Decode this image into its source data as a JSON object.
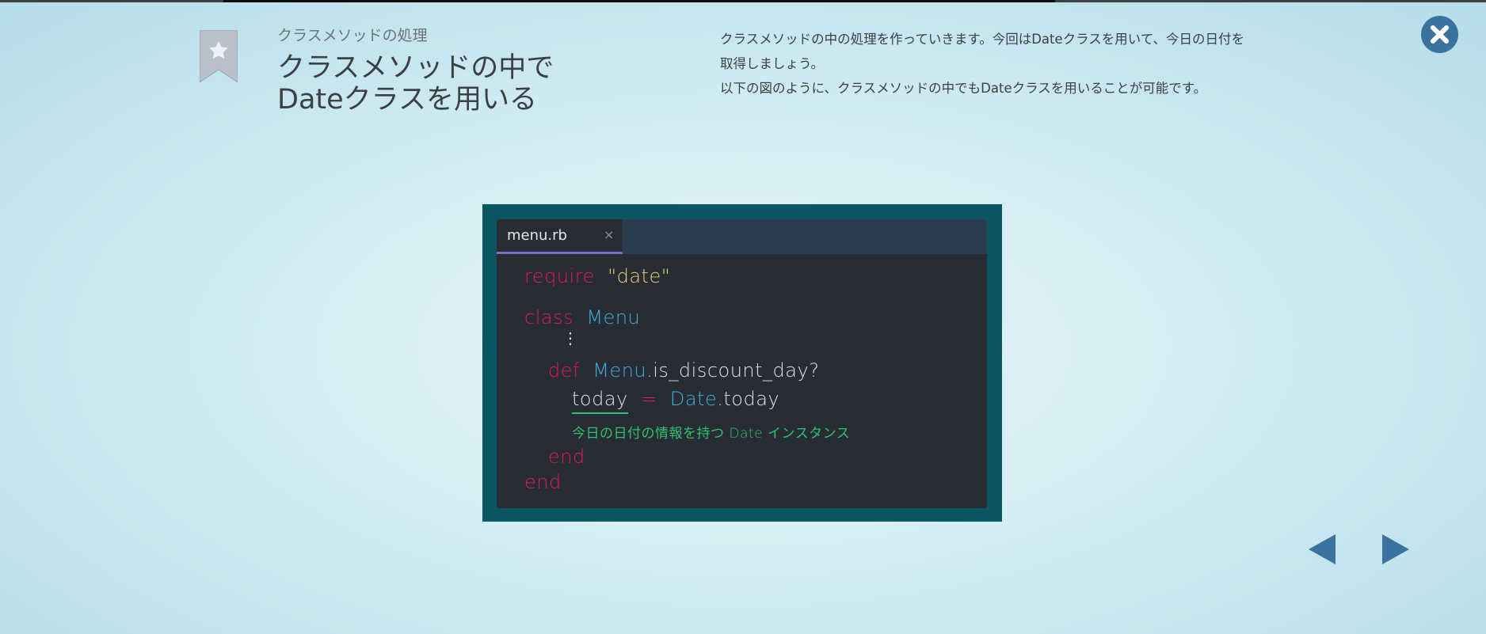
{
  "header": {
    "subtitle": "クラスメソッドの処理",
    "title_line1": "クラスメソッドの中で",
    "title_line2": "Dateクラスを用いる",
    "description": [
      "クラスメソッドの中の処理を作っていきます。今回はDateクラスを用いて、今日の日付を",
      "取得しましょう。",
      "以下の図のように、クラスメソッドの中でもDateクラスを用いることが可能です。"
    ]
  },
  "icons": {
    "bookmark": "bookmark-star-icon",
    "close": "close-icon",
    "prev": "triangle-left-icon",
    "next": "triangle-right-icon"
  },
  "editor": {
    "tab_name": "menu.rb",
    "tab_close": "×",
    "code": {
      "require_kw": "require",
      "require_str": "\"date\"",
      "class_kw": "class",
      "class_name": "Menu",
      "ellipsis": "⋮",
      "def_kw": "def",
      "def_cls": "Menu",
      "def_method": ".is_discount_day?",
      "var": "today",
      "op": "=",
      "date_cls": "Date",
      "date_method": ".today",
      "note": "今日の日付の情報を持つ Date インスタンス",
      "end1": "end",
      "end2": "end"
    }
  },
  "colors": {
    "keyword": "#e8194f",
    "string": "#e6d37a",
    "class": "#3fb0dd",
    "note": "#2fc26a",
    "frame": "#0c5562",
    "accent": "#3b73a0"
  }
}
